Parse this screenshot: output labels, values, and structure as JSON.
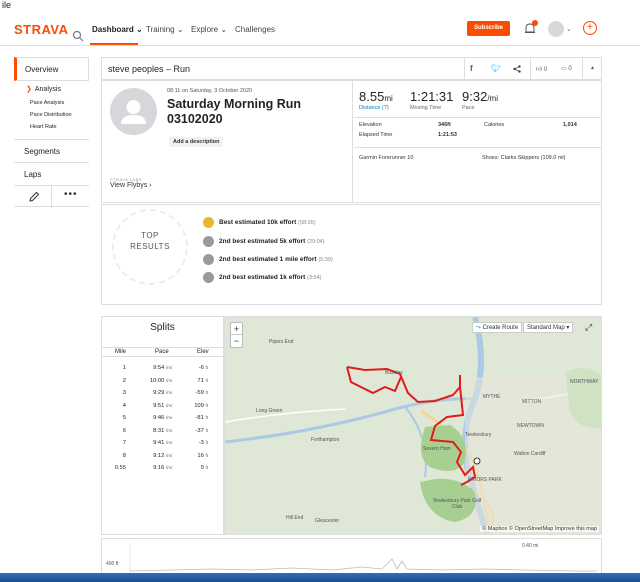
{
  "window_title": "ile",
  "nav": {
    "logo": "STRAVA",
    "items": [
      "Dashboard ⌄",
      "Training ⌄",
      "Explore ⌄",
      "Challenges"
    ],
    "subscribe": "Subscribe",
    "notification_count": "1"
  },
  "sidebar": {
    "overview": "Overview",
    "analysis": "Analysis",
    "sub_items": [
      "Pace Analysis",
      "Pace Distribution",
      "Heart Rate"
    ],
    "segments": "Segments",
    "laps": "Laps",
    "more": "•••"
  },
  "header": {
    "title": "steve peoples – Run",
    "kudos": "0",
    "comments": "0"
  },
  "activity": {
    "date": "08:11 on Saturday, 3 October 2020",
    "title": "Saturday Morning Run 03102020",
    "add_description": "Add a description",
    "strava_labs": "STRAVA LABS",
    "flybys": "View Flybys ›"
  },
  "stats": {
    "distance_value": "8.55",
    "distance_unit": "mi",
    "distance_label": "Distance (?)",
    "moving_time_value": "1:21:31",
    "moving_time_label": "Moving Time",
    "pace_value": "9:32",
    "pace_unit": "/mi",
    "pace_label": "Pace",
    "elevation_label": "Elevation",
    "elevation_value": "346ft",
    "calories_label": "Calories",
    "calories_value": "1,014",
    "elapsed_label": "Elapsed Time",
    "elapsed_value": "1:21:53",
    "device": "Garmin Forerunner 10",
    "shoes": "Shoes: Clarks Skippers (109.0 mi)"
  },
  "results": {
    "top_line1": "TOP",
    "top_line2": "RESULTS",
    "efforts": [
      {
        "text": "Best estimated 10k effort",
        "time": "(58:26)",
        "medal": "gold"
      },
      {
        "text": "2nd best estimated 5k effort",
        "time": "(29:04)",
        "medal": "silver"
      },
      {
        "text": "2nd best estimated 1 mile effort",
        "time": "(5:39)",
        "medal": "silver"
      },
      {
        "text": "2nd best estimated 1k effort",
        "time": "(3:54)",
        "medal": "silver"
      }
    ]
  },
  "splits": {
    "title": "Splits",
    "headers": [
      "Mile",
      "Pace",
      "Elev"
    ],
    "rows": [
      {
        "mile": "1",
        "pace": "9:54",
        "pace_unit": "/mi",
        "elev": "-6",
        "elev_unit": "ft"
      },
      {
        "mile": "2",
        "pace": "10:00",
        "pace_unit": "/mi",
        "elev": "71",
        "elev_unit": "ft"
      },
      {
        "mile": "3",
        "pace": "9:29",
        "pace_unit": "/mi",
        "elev": "-59",
        "elev_unit": "ft"
      },
      {
        "mile": "4",
        "pace": "9:51",
        "pace_unit": "/mi",
        "elev": "109",
        "elev_unit": "ft"
      },
      {
        "mile": "5",
        "pace": "9:46",
        "pace_unit": "/mi",
        "elev": "-81",
        "elev_unit": "ft"
      },
      {
        "mile": "6",
        "pace": "8:31",
        "pace_unit": "/mi",
        "elev": "-37",
        "elev_unit": "ft"
      },
      {
        "mile": "7",
        "pace": "9:41",
        "pace_unit": "/mi",
        "elev": "-3",
        "elev_unit": "ft"
      },
      {
        "mile": "8",
        "pace": "9:12",
        "pace_unit": "/mi",
        "elev": "16",
        "elev_unit": "ft"
      },
      {
        "mile": "0.55",
        "pace": "9:16",
        "pace_unit": "/mi",
        "elev": "9",
        "elev_unit": "ft"
      }
    ]
  },
  "map": {
    "zoom_in": "+",
    "zoom_out": "−",
    "create_route": "Create Route",
    "map_style": "Standard Map ▾",
    "attribution": "© Mapbox © OpenStreetMap Improve this map",
    "labels": [
      "Pipers End",
      "Bushley",
      "Long Green",
      "Forthampton",
      "Tewkesbury",
      "Severn Ham",
      "Tewkesbury Park Golf Club",
      "Hill End",
      "Gleucester",
      "MYTHE",
      "MITTON",
      "NEWTOWN",
      "NORTHWAY",
      "Walton Cardiff",
      "PRIORS PARK"
    ]
  },
  "elevation": {
    "y_label": "400 ft",
    "x_label": "0.40 mi"
  }
}
